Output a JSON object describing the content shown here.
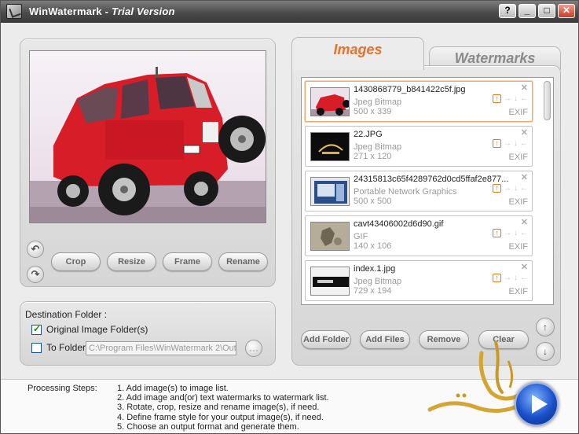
{
  "window": {
    "app_name": "WinWatermark",
    "title_suffix": " - Trial Version",
    "buttons": {
      "help": "?",
      "minimize": "_",
      "maximize": "□",
      "close": "✕"
    }
  },
  "preview": {
    "rotate_left_icon": "↶",
    "rotate_right_icon": "↷",
    "crop_label": "Crop",
    "resize_label": "Resize",
    "frame_label": "Frame",
    "rename_label": "Rename"
  },
  "destination": {
    "title": "Destination Folder :",
    "original_label": "Original Image Folder(s)",
    "original_checked": true,
    "to_folder_label": "To Folder",
    "to_folder_checked": false,
    "path": "C:\\Program Files\\WinWatermark 2\\Out"
  },
  "tabs": {
    "images": "Images",
    "watermarks": "Watermarks"
  },
  "images": [
    {
      "name": "1430868779_b841422c5f.jpg",
      "type": "Jpeg Bitmap",
      "size": "500 x 339",
      "exif": "EXIF",
      "selected": true
    },
    {
      "name": "22.JPG",
      "type": "Jpeg Bitmap",
      "size": "271 x 120",
      "exif": "EXIF",
      "selected": false
    },
    {
      "name": "24315813c65f4289762d0cd5ffaf2e877...",
      "type": "Portable Network Graphics",
      "size": "500 x 500",
      "exif": "EXIF",
      "selected": false
    },
    {
      "name": "cavt43406002d6d90.gif",
      "type": "GIF",
      "size": "140 x 106",
      "exif": "EXIF",
      "selected": false
    },
    {
      "name": "index.1.jpg",
      "type": "Jpeg Bitmap",
      "size": "729 x 194",
      "exif": "EXIF",
      "selected": false
    }
  ],
  "image_actions": {
    "add_folder": "Add Folder",
    "add_files": "Add Files",
    "remove": "Remove",
    "clear": "Clear",
    "move_up_icon": "↑",
    "move_down_icon": "↓"
  },
  "steps": {
    "title": "Processing Steps:",
    "items": [
      "1. Add image(s) to image list.",
      "2. Add image and(or) text watermarks to watermark list.",
      "3. Rotate, crop, resize and rename image(s), if need.",
      "4. Define frame style for your output image(s), if need.",
      "5. Choose an output format and generate them."
    ]
  },
  "colors": {
    "accent": "#e8722f",
    "titlebar": "#4a4a4a",
    "selection": "#f0a668"
  },
  "icons": {
    "app": "app-icon",
    "generate": "play-icon",
    "logo": "arabic-calligraphy-logo"
  }
}
